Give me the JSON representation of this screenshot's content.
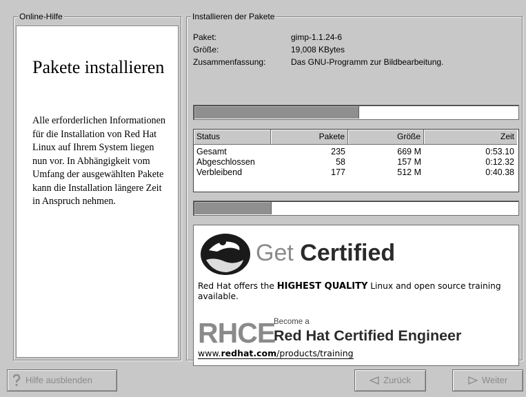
{
  "help": {
    "frame_title": "Online-Hilfe",
    "heading": "Pakete installieren",
    "body": "Alle erforderlichen Informationen für die Installation von Red Hat Linux auf Ihrem System liegen nun vor. In Abhängigkeit vom Umfang der ausgewählten Pakete kann die Installation längere Zeit in Anspruch nehmen."
  },
  "install": {
    "frame_title": "Installieren der Pakete",
    "package_label": "Paket:",
    "package_value": "gimp-1.1.24-6",
    "size_label": "Größe:",
    "size_value": "19,008 KBytes",
    "summary_label": "Zusammenfassung:",
    "summary_value": "Das GNU-Programm zur Bildbearbeitung.",
    "package_progress": 0.505,
    "total_progress": 0.235
  },
  "status_table": {
    "headers": [
      "Status",
      "Pakete",
      "Größe",
      "Zeit"
    ],
    "rows": [
      [
        "Gesamt",
        "235",
        "669 M",
        "0:53.10"
      ],
      [
        "Abgeschlossen",
        "58",
        "157 M",
        "0:12.32"
      ],
      [
        "Verbleibend",
        "177",
        "512 M",
        "0:40.38"
      ]
    ]
  },
  "ad": {
    "get": "Get",
    "certified": "Certified",
    "line_pre": "Red Hat offers the",
    "line_strong": "HIGHEST QUALITY",
    "line_post": "Linux and open source training available.",
    "rhce": "RHCE",
    "become": "Become a",
    "rhce_title": "Red Hat Certified Engineer",
    "url_pre": "www.",
    "url_bold": "redhat.com",
    "url_post": "/products/training"
  },
  "buttons": {
    "help_label": "Hilfe ausblenden",
    "back_label": "Zurück",
    "next_label": "Weiter"
  },
  "icons": {
    "help": "question-icon",
    "back": "triangle-left-icon",
    "next": "triangle-right-icon",
    "logo": "redhat-shadowman-logo"
  }
}
